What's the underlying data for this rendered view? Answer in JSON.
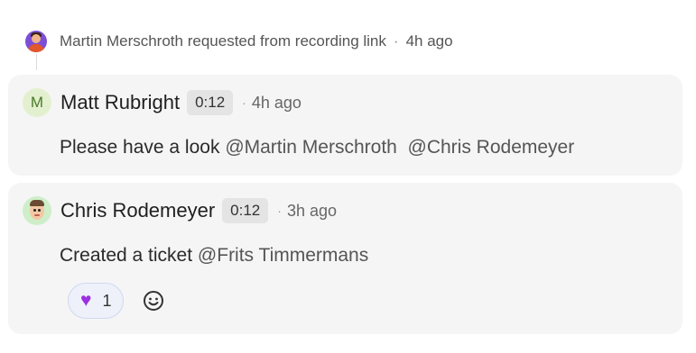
{
  "activity": {
    "actor": "Martin Merschroth",
    "action": "requested from recording link",
    "separator": "·",
    "time_ago": "4h ago"
  },
  "comments": [
    {
      "author": "Matt Rubright",
      "avatar_initial": "M",
      "timestamp": "0:12",
      "separator": "·",
      "time_ago": "4h ago",
      "text": "Please have a look",
      "mentions": [
        "@Martin Merschroth",
        "@Chris Rodemeyer"
      ]
    },
    {
      "author": "Chris Rodemeyer",
      "timestamp": "0:12",
      "separator": "·",
      "time_ago": "3h ago",
      "text": "Created a ticket",
      "mentions": [
        "@Frits Timmermans"
      ],
      "reactions": [
        {
          "emoji": "💜",
          "icon": "purple-heart-icon",
          "count": "1"
        }
      ]
    }
  ],
  "colors": {
    "card_bg": "#f5f5f5",
    "chip_bg": "#e4e4e4",
    "reaction_bg": "#eef1fa",
    "reaction_border": "#cfd8f0",
    "heart": "#9b30e0"
  }
}
